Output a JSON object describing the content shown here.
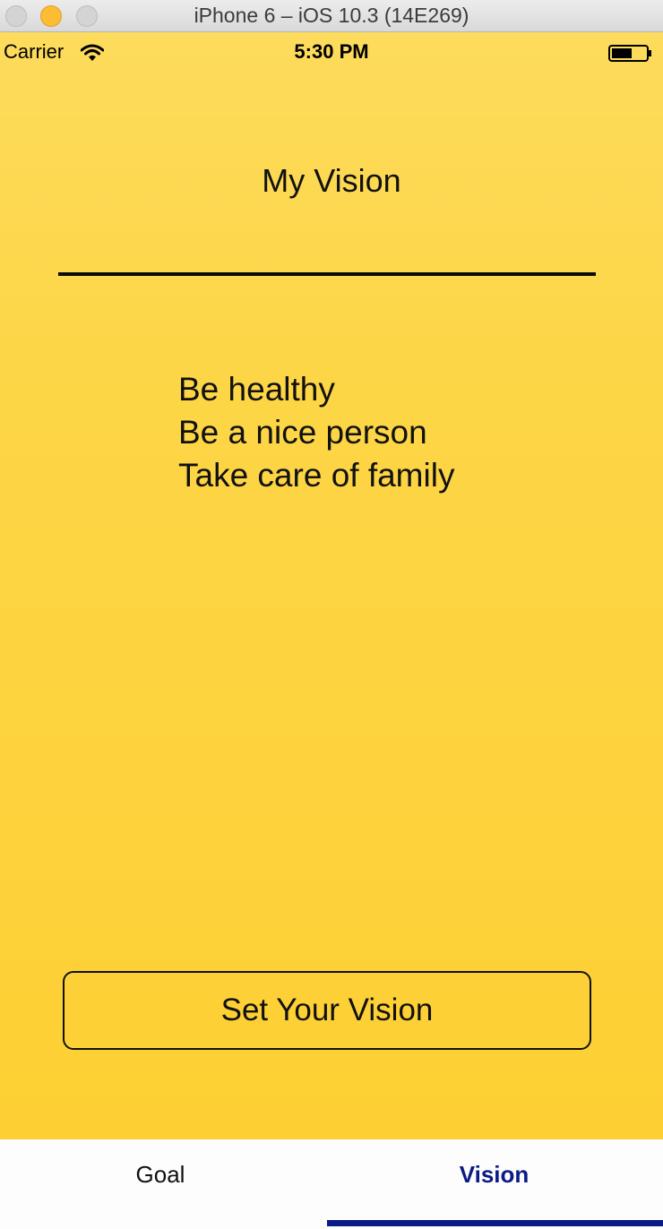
{
  "window": {
    "title": "iPhone 6 – iOS 10.3 (14E269)"
  },
  "status_bar": {
    "carrier": "Carrier",
    "time": "5:30 PM",
    "icons": [
      "wifi-icon",
      "battery-icon"
    ]
  },
  "main": {
    "title": "My Vision",
    "vision_items": [
      "Be healthy",
      "Be a nice person",
      "Take care of family"
    ],
    "set_vision_label": "Set Your Vision"
  },
  "tab_bar": {
    "tabs": [
      {
        "label": "Goal",
        "selected": false
      },
      {
        "label": "Vision",
        "selected": true
      }
    ]
  },
  "colors": {
    "background_top": "#fddb5c",
    "background_bottom": "#fdcf33",
    "selected_tab": "#0a1a86",
    "text": "#111111"
  }
}
